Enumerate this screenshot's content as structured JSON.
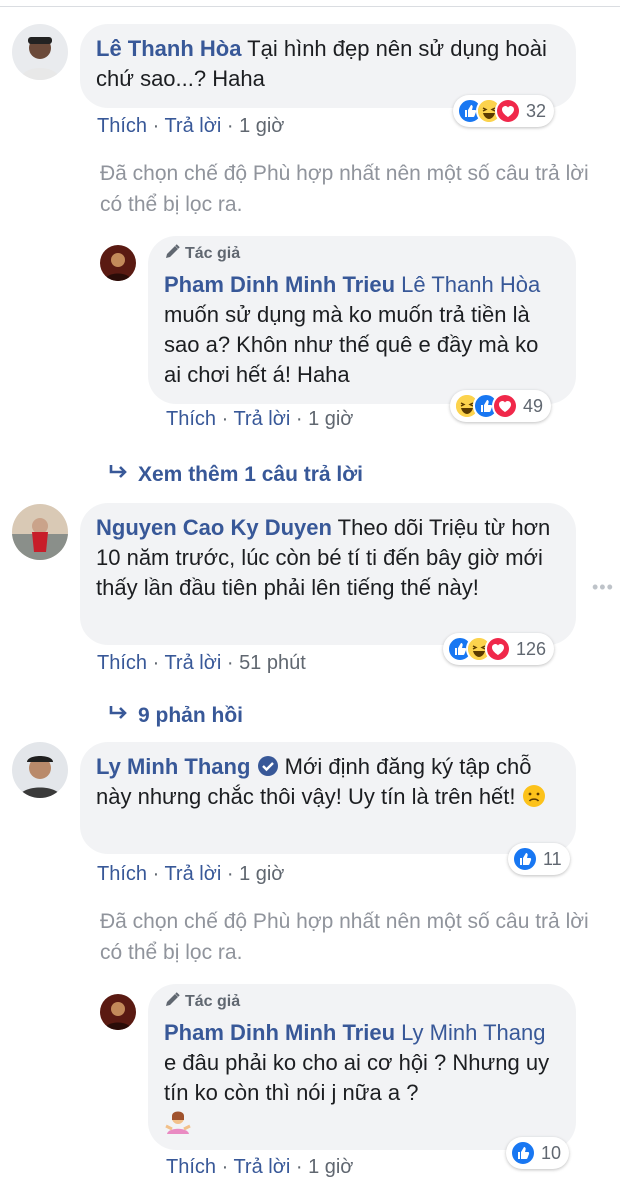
{
  "comments": [
    {
      "name": "Lê Thanh Hòa",
      "text": "Tại hình đẹp nên sử dụng hoài chứ sao...? Haha",
      "like": "Thích",
      "reply": "Trả lời",
      "time": "1 giờ",
      "reaction_count": "32",
      "filtered_note": "Đã chọn chế độ Phù hợp nhất nên một số câu trả lời có thể bị lọc ra.",
      "replies": [
        {
          "author_tag": "Tác giả",
          "name": "Pham Dinh Minh Trieu",
          "mention": "Lê Thanh Hòa",
          "text": "muốn sử dụng mà ko muốn trả tiền là sao a? Khôn như thế quê e đầy mà ko ai chơi hết á! Haha",
          "like": "Thích",
          "reply": "Trả lời",
          "time": "1 giờ",
          "reaction_count": "49"
        }
      ],
      "more_replies": "Xem thêm 1 câu trả lời"
    },
    {
      "name": "Nguyen Cao Ky Duyen",
      "text": "Theo dõi Triệu từ hơn 10 năm trước, lúc còn bé tí ti đến bây giờ mới thấy lần đầu tiên phải lên tiếng thế này!",
      "like": "Thích",
      "reply": "Trả lời",
      "time": "51 phút",
      "reaction_count": "126",
      "more_replies": "9 phản hồi"
    },
    {
      "name": "Ly Minh Thang",
      "verified": true,
      "text": "Mới định đăng ký tập chỗ này nhưng chắc thôi vậy! Uy tín là trên hết!",
      "like": "Thích",
      "reply": "Trả lời",
      "time": "1 giờ",
      "reaction_count": "11",
      "filtered_note": "Đã chọn chế độ Phù hợp nhất nên một số câu trả lời có thể bị lọc ra.",
      "replies": [
        {
          "author_tag": "Tác giả",
          "name": "Pham Dinh Minh Trieu",
          "mention": "Ly Minh Thang",
          "text": "e đâu phải ko cho ai cơ hội ? Nhưng uy tín ko còn thì nói j nữa a ?",
          "like": "Thích",
          "reply": "Trả lời",
          "time": "1 giờ",
          "reaction_count": "10"
        }
      ]
    }
  ],
  "colors": {
    "link": "#385898",
    "bubble": "#f2f3f5",
    "meta": "#606770",
    "note": "#90949c"
  }
}
